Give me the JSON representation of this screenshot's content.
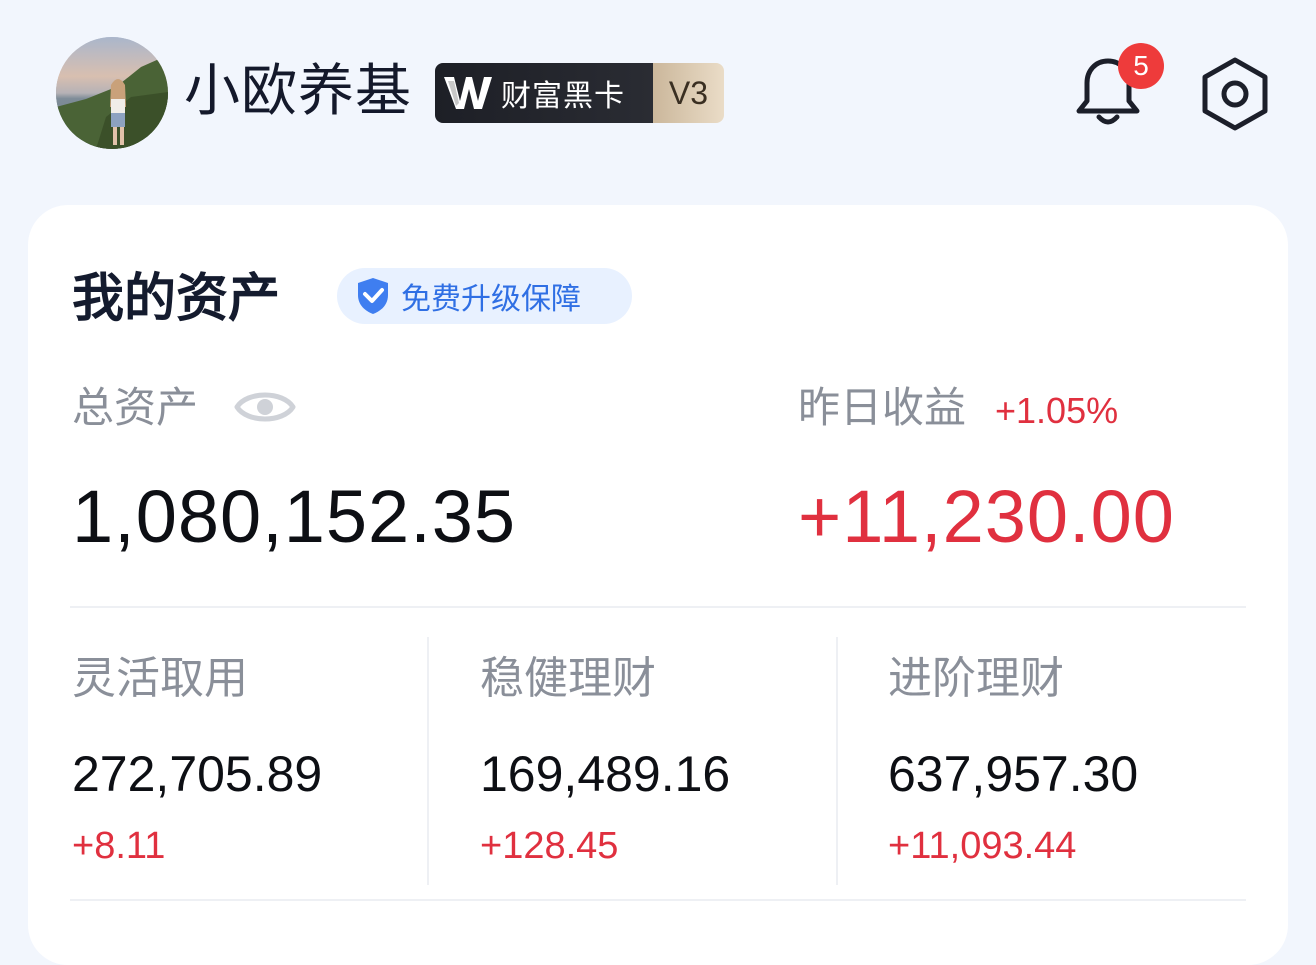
{
  "header": {
    "username": "小欧养基",
    "vip_text": "财富黑卡",
    "vip_level": "V3",
    "notification_count": "5"
  },
  "assets": {
    "title": "我的资产",
    "guarantee_label": "免费升级保障",
    "total_label": "总资产",
    "total_value": "1,080,152.35",
    "yesterday_label": "昨日收益",
    "yesterday_pct": "+1.05%",
    "yesterday_value": "+11,230.00",
    "categories": [
      {
        "label": "灵活取用",
        "value": "272,705.89",
        "gain": "+8.11"
      },
      {
        "label": "稳健理财",
        "value": "169,489.16",
        "gain": "+128.45"
      },
      {
        "label": "进阶理财",
        "value": "637,957.30",
        "gain": "+11,093.44"
      }
    ]
  },
  "colors": {
    "background": "#f2f6fd",
    "gain_red": "#e0303f",
    "guarantee_blue": "#2f6fe4",
    "badge_red": "#ee3b3b"
  },
  "icons": [
    "bell-icon",
    "settings-icon",
    "shield-icon",
    "eye-icon",
    "vip-logo-icon"
  ]
}
